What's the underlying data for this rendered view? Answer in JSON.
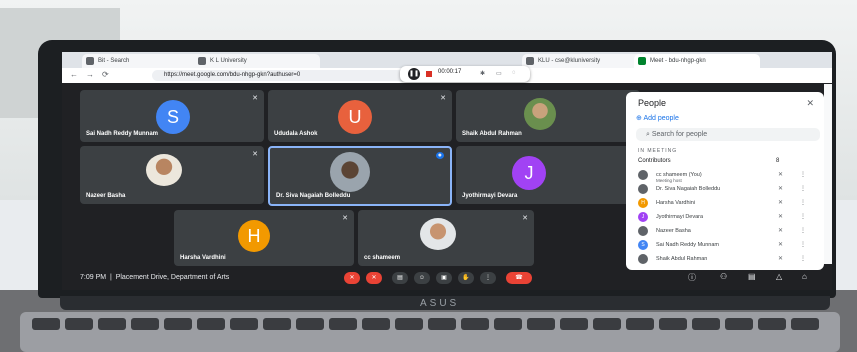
{
  "browser": {
    "tabs": [
      {
        "label": "Bit - Search"
      },
      {
        "label": "K L University"
      },
      {
        "label": "KLU - cse@kluniversity"
      },
      {
        "label": "Meet - bdu-nhgp-gkn"
      }
    ],
    "url": "https://meet.google.com/bdu-nhgp-gkn?authuser=0"
  },
  "recording": {
    "time": "00:00:17"
  },
  "meeting": {
    "clock": "7:09 PM",
    "title": "Placement Drive, Department of Arts",
    "tiles": [
      {
        "name": "Sai Nadh Reddy Munnam",
        "initial": "S",
        "color": "#4285f4"
      },
      {
        "name": "Ududala Ashok",
        "initial": "U",
        "color": "#e8613d"
      },
      {
        "name": "Shaik Abdul Rahman",
        "initial": "",
        "color": ""
      },
      {
        "name": "Nazeer Basha",
        "initial": "",
        "color": ""
      },
      {
        "name": "Dr. Siva Nagaiah Bolleddu",
        "initial": "",
        "color": ""
      },
      {
        "name": "Jyothirmayi Devara",
        "initial": "J",
        "color": "#a142f4"
      },
      {
        "name": "Harsha Vardhini",
        "initial": "H",
        "color": "#f29900"
      },
      {
        "name": "cc shameem",
        "initial": "",
        "color": ""
      }
    ]
  },
  "people_panel": {
    "title": "People",
    "close_icon": "close-icon",
    "add_people": "Add people",
    "search_placeholder": "Search for people",
    "section": "IN MEETING",
    "contributors_label": "Contributors",
    "contributors_count": "8",
    "rows": [
      {
        "name": "cc shameem (You)",
        "sub": "Meeting host",
        "color": "#5f6368",
        "initial": ""
      },
      {
        "name": "Dr. Siva Nagaiah Bolleddu",
        "color": "#5f6368",
        "initial": ""
      },
      {
        "name": "Harsha Vardhini",
        "color": "#f29900",
        "initial": "H"
      },
      {
        "name": "Jyothirmayi Devara",
        "color": "#a142f4",
        "initial": "J"
      },
      {
        "name": "Nazeer Basha",
        "color": "#5f6368",
        "initial": ""
      },
      {
        "name": "Sai Nadh Reddy Munnam",
        "color": "#4285f4",
        "initial": "S"
      },
      {
        "name": "Shaik Abdul Rahman",
        "color": "#5f6368",
        "initial": ""
      }
    ]
  },
  "laptop": {
    "brand": "ASUS"
  }
}
